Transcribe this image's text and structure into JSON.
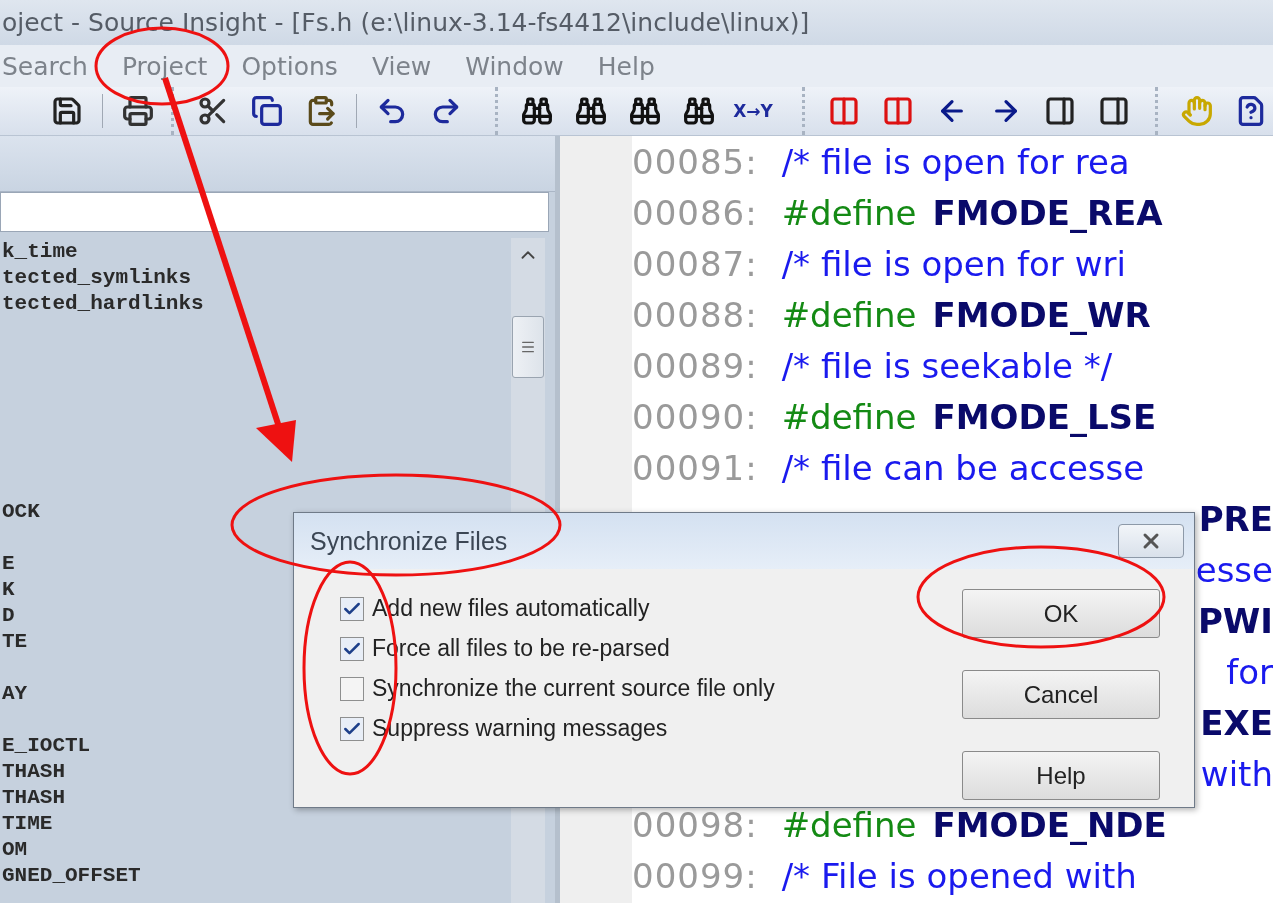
{
  "window": {
    "title": "oject - Source Insight - [Fs.h (e:\\linux-3.14-fs4412\\include\\linux)]"
  },
  "menu": [
    "Search",
    "Project",
    "Options",
    "View",
    "Window",
    "Help"
  ],
  "toolbar": {
    "replace_label": "X→Y"
  },
  "symbols": [
    {
      "kind": "symbol",
      "name": "k_time"
    },
    {
      "kind": "symbol",
      "name": "tected_symlinks"
    },
    {
      "kind": "symbol",
      "name": "tected_hardlinks"
    },
    {
      "kind": "blank"
    },
    {
      "kind": "blank"
    },
    {
      "kind": "blank"
    },
    {
      "kind": "blank"
    },
    {
      "kind": "blank"
    },
    {
      "kind": "blank"
    },
    {
      "kind": "blank"
    },
    {
      "kind": "symbol",
      "name": "OCK"
    },
    {
      "kind": "blank"
    },
    {
      "kind": "symbol",
      "name": "E"
    },
    {
      "kind": "symbol",
      "name": "K"
    },
    {
      "kind": "symbol",
      "name": "D"
    },
    {
      "kind": "symbol",
      "name": "TE"
    },
    {
      "kind": "blank"
    },
    {
      "kind": "symbol",
      "name": "AY"
    },
    {
      "kind": "blank"
    },
    {
      "kind": "symbol",
      "name": "E_IOCTL"
    },
    {
      "kind": "symbol",
      "name": "THASH"
    },
    {
      "kind": "symbol",
      "name": "THASH"
    },
    {
      "kind": "symbol",
      "name": "TIME"
    },
    {
      "kind": "symbol",
      "name": "OM"
    },
    {
      "kind": "symbol",
      "name": "GNED_OFFSET"
    }
  ],
  "code": [
    {
      "number": "00085:",
      "parts": [
        {
          "kind": "comment",
          "text": "/* file is open for rea"
        }
      ]
    },
    {
      "number": "00086:",
      "parts": [
        {
          "kind": "directive",
          "text": "#define"
        },
        {
          "kind": "macro",
          "text": "FMODE_REA"
        }
      ]
    },
    {
      "number": "00087:",
      "parts": [
        {
          "kind": "comment",
          "text": "/* file is open for wri"
        }
      ]
    },
    {
      "number": "00088:",
      "parts": [
        {
          "kind": "directive",
          "text": "#define"
        },
        {
          "kind": "macro",
          "text": "FMODE_WR"
        }
      ]
    },
    {
      "number": "00089:",
      "parts": [
        {
          "kind": "comment",
          "text": "/* file is seekable */"
        }
      ]
    },
    {
      "number": "00090:",
      "parts": [
        {
          "kind": "directive",
          "text": "#define"
        },
        {
          "kind": "macro",
          "text": "FMODE_LSE"
        }
      ]
    },
    {
      "number": "00091:",
      "parts": [
        {
          "kind": "comment",
          "text": "/* file can be accesse"
        }
      ]
    },
    {
      "parts": [
        {
          "kind": "macro",
          "text": "PRE"
        }
      ]
    },
    {
      "parts": [
        {
          "kind": "comment",
          "text": "esse"
        }
      ]
    },
    {
      "parts": [
        {
          "kind": "macro",
          "text": "PWI"
        }
      ]
    },
    {
      "parts": [
        {
          "kind": "comment",
          "text": "for"
        }
      ]
    },
    {
      "parts": [
        {
          "kind": "macro",
          "text": "EXE"
        }
      ]
    },
    {
      "parts": [
        {
          "kind": "comment",
          "text": "with"
        }
      ]
    },
    {
      "number": "00098:",
      "parts": [
        {
          "kind": "directive",
          "text": "#define"
        },
        {
          "kind": "macro",
          "text": "FMODE_NDE"
        }
      ]
    },
    {
      "number": "00099:",
      "parts": [
        {
          "kind": "comment",
          "text": "/* File is opened with"
        }
      ]
    }
  ],
  "dialog": {
    "title": "Synchronize Files",
    "checkboxes": [
      {
        "label": "Add new files automatically",
        "checked": true
      },
      {
        "label": "Force all files to be re-parsed",
        "checked": true
      },
      {
        "label": "Synchronize the current source file only",
        "checked": false
      },
      {
        "label": "Suppress warning messages",
        "checked": true
      }
    ],
    "buttons": [
      "OK",
      "Cancel",
      "Help"
    ]
  }
}
